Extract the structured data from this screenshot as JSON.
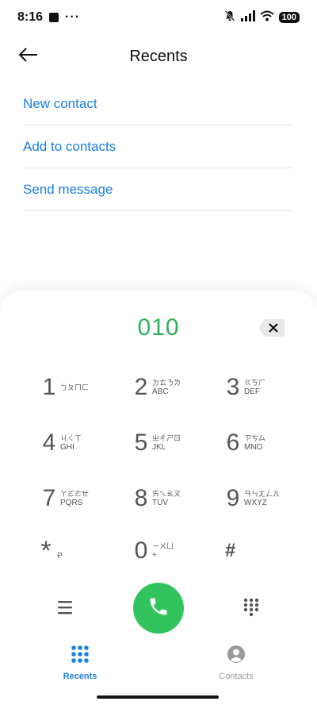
{
  "status_bar": {
    "time": "8:16",
    "dots": "···",
    "battery": "100"
  },
  "header": {
    "title": "Recents"
  },
  "actions": [
    {
      "label": "New contact"
    },
    {
      "label": "Add to contacts"
    },
    {
      "label": "Send message"
    }
  ],
  "dialer": {
    "number": "010",
    "keys": [
      {
        "digit": "1",
        "bpmf": "ㄅㄆㄇㄈ",
        "letters": ""
      },
      {
        "digit": "2",
        "bpmf": "ㄉㄊㄋㄌ",
        "letters": "ABC"
      },
      {
        "digit": "3",
        "bpmf": "ㄍㄎㄏ",
        "letters": "DEF"
      },
      {
        "digit": "4",
        "bpmf": "ㄐㄑㄒ",
        "letters": "GHI"
      },
      {
        "digit": "5",
        "bpmf": "ㄓㄔㄕㄖ",
        "letters": "JKL"
      },
      {
        "digit": "6",
        "bpmf": "ㄗㄘㄙ",
        "letters": "MNO"
      },
      {
        "digit": "7",
        "bpmf": "ㄚㄛㄜㄝ",
        "letters": "PQRS"
      },
      {
        "digit": "8",
        "bpmf": "ㄞㄟㄠㄡ",
        "letters": "TUV"
      },
      {
        "digit": "9",
        "bpmf": "ㄢㄣㄤㄥㄦ",
        "letters": "WXYZ"
      },
      {
        "digit": "*",
        "bpmf": "",
        "letters": "P"
      },
      {
        "digit": "0",
        "bpmf": "ㄧㄨㄩ",
        "letters": "+"
      },
      {
        "digit": "#",
        "bpmf": "",
        "letters": ""
      }
    ]
  },
  "bottom_nav": {
    "recents": "Recents",
    "contacts": "Contacts"
  },
  "colors": {
    "accent_blue": "#1b7fe0",
    "number_green": "#2db35a",
    "call_green": "#31c45d",
    "inactive_gray": "#9a9a9a"
  },
  "icons": {
    "back": "arrow-left-icon",
    "backspace": "backspace-icon",
    "call": "phone-icon",
    "menu": "menu-icon",
    "dialpad": "dialpad-icon",
    "recents": "dialpad-grid-icon",
    "contacts": "person-icon",
    "mute": "bell-off-icon",
    "signal": "signal-icon",
    "wifi": "wifi-icon"
  }
}
